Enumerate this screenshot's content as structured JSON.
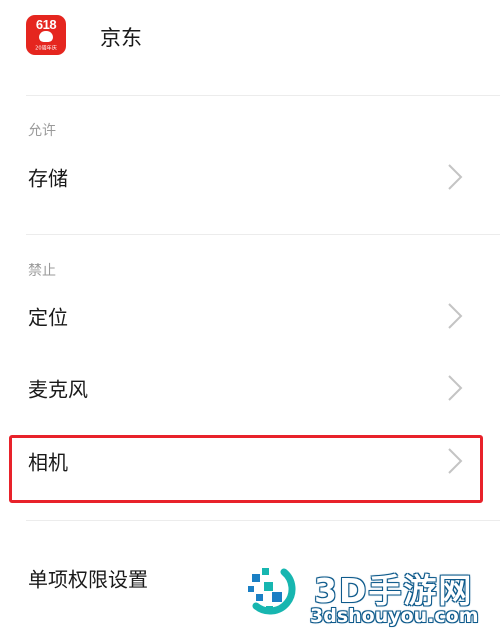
{
  "app": {
    "name": "京东",
    "icon": "jd-618-app-icon",
    "icon_number": "618",
    "icon_caption": "20周年庆",
    "icon_color": "#e5261f"
  },
  "sections": [
    {
      "label": "允许",
      "items": [
        {
          "label": "存储",
          "icon": "chevron-right-icon"
        }
      ]
    },
    {
      "label": "禁止",
      "items": [
        {
          "label": "定位",
          "icon": "chevron-right-icon"
        },
        {
          "label": "麦克风",
          "icon": "chevron-right-icon"
        },
        {
          "label": "相机",
          "icon": "chevron-right-icon",
          "highlighted": true
        }
      ]
    }
  ],
  "single_permission_settings": {
    "label": "单项权限设置"
  },
  "watermark": {
    "title": "3D手游网",
    "url": "3dshouyou.com",
    "icon": "3dshouyou-logo-icon"
  },
  "colors": {
    "highlight": "#e8222a",
    "section_label": "#9a9a9a",
    "divider": "#ececec"
  }
}
